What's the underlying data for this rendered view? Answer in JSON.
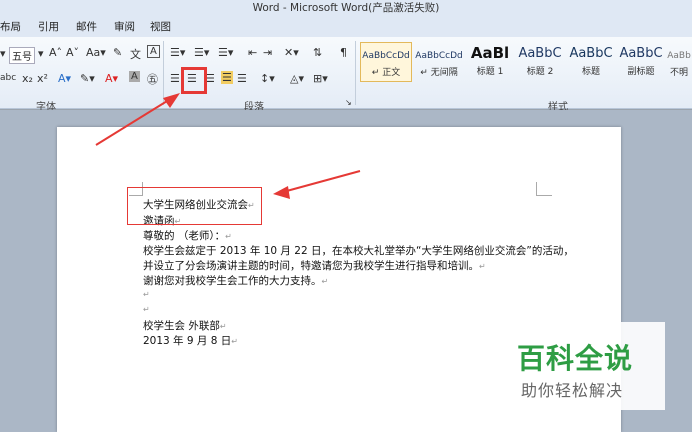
{
  "window": {
    "title": "Word - Microsoft Word(产品激活失败)"
  },
  "menu": {
    "tabs": [
      "布局",
      "引用",
      "邮件",
      "审阅",
      "视图"
    ]
  },
  "ribbon": {
    "font_size": "五号",
    "font_group_label": "字体",
    "paragraph_group_label": "段落",
    "styles_group_label": "样式",
    "styles": [
      {
        "sample": "AaBbCcDd",
        "name": "↵ 正文"
      },
      {
        "sample": "AaBbCcDd",
        "name": "↵ 无间隔"
      },
      {
        "sample": "AaBl",
        "name": "标题 1"
      },
      {
        "sample": "AaBbC",
        "name": "标题 2"
      },
      {
        "sample": "AaBbC",
        "name": "标题"
      },
      {
        "sample": "AaBbC",
        "name": "副标题"
      },
      {
        "sample": "AaBb",
        "name": "不明"
      }
    ]
  },
  "document": {
    "lines": [
      "大学生网络创业交流会",
      "邀请函",
      "尊敬的          （老师）：",
      "校学生会兹定于 2013 年 10 月 22 日，在本校大礼堂举办“大学生网络创业交流会”的活动，",
      "并设立了分会场演讲主题的时间，特邀请您为我校学生进行指导和培训。",
      "谢谢您对我校学生会工作的大力支持。",
      "",
      "",
      "校学生会 外联部",
      "2013 年 9 月 8 日"
    ]
  },
  "watermark": {
    "title": "百科全说",
    "subtitle": "助你轻松解决"
  },
  "colors": {
    "highlight": "#e53935",
    "watermark_green": "#2e9d44"
  }
}
